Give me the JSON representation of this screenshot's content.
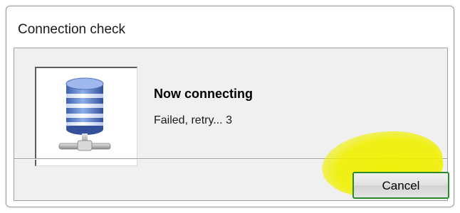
{
  "window": {
    "title": "Connection check"
  },
  "message": {
    "title": "Now connecting",
    "status": "Failed, retry... 3"
  },
  "buttons": {
    "cancel_label": "Cancel"
  },
  "icons": {
    "main": "database-server-icon"
  },
  "colors": {
    "highlight": "#f0f000",
    "button_border": "#2a8a2a",
    "panel_bg": "#f0f0f0"
  }
}
